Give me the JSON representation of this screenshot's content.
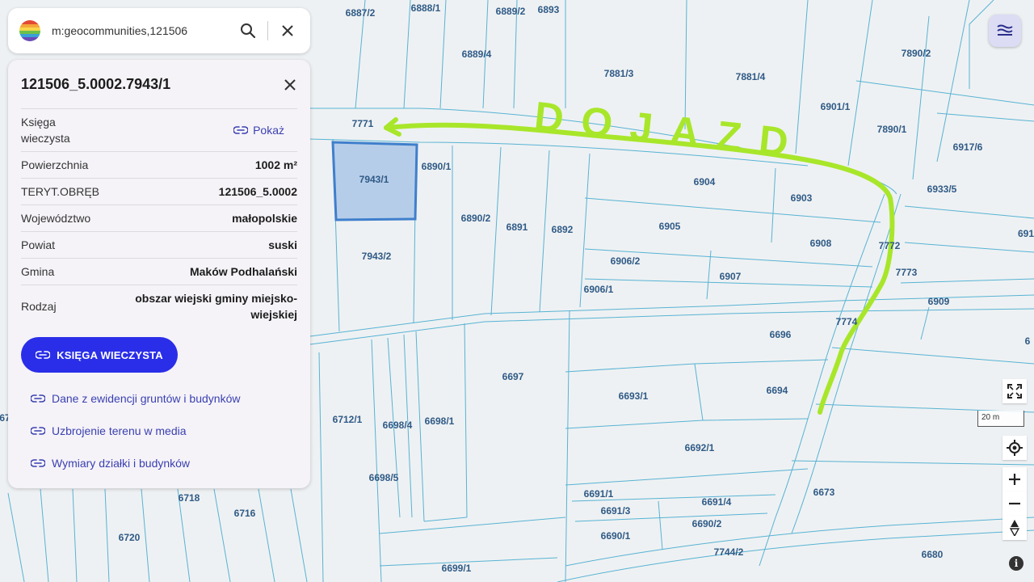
{
  "search": {
    "query": "m:geocommunities,121506"
  },
  "panel": {
    "title": "121506_5.0002.7943/1",
    "ksiega_label": "Księga wieczysta",
    "show_label": "Pokaż",
    "rows": [
      {
        "label": "Powierzchnia",
        "value": "1002 m²"
      },
      {
        "label": "TERYT.OBRĘB",
        "value": "121506_5.0002"
      },
      {
        "label": "Województwo",
        "value": "małopolskie"
      },
      {
        "label": "Powiat",
        "value": "suski"
      },
      {
        "label": "Gmina",
        "value": "Maków Podhalański"
      },
      {
        "label": "Rodzaj",
        "value": "obszar wiejski gminy miejsko-wiejskiej"
      }
    ],
    "button_label": "KSIĘGA WIECZYSTA",
    "links": [
      "Dane z ewidencji gruntów i budynków",
      "Uzbrojenie terenu w media",
      "Wymiary działki i budynków"
    ]
  },
  "map": {
    "parcels": [
      "6887/2",
      "6888/1",
      "6889/2",
      "6893",
      "6889/4",
      "7881/3",
      "7881/4",
      "7890/2",
      "7771",
      "6901/1",
      "7890/1",
      "6917/6",
      "7943/1",
      "6890/1",
      "6904",
      "6903",
      "6933/5",
      "6890/2",
      "6891",
      "6892",
      "6905",
      "6908",
      "7772",
      "691",
      "7943/2",
      "6906/2",
      "6907",
      "7773",
      "6906/1",
      "6909",
      "6696",
      "7774",
      "6697",
      "6693/1",
      "6694",
      "6712/1",
      "6698/4",
      "6698/1",
      "6692/1",
      "6698/5",
      "6673",
      "6718",
      "6716",
      "6691/1",
      "6691/4",
      "6691/3",
      "6690/2",
      "6720",
      "6690/1",
      "7744/2",
      "6680",
      "6699/1",
      "67",
      "6"
    ],
    "annotation": "DOJAZD",
    "scale_label": "20 m",
    "highlight_color": "#b6cde9",
    "annotation_color": "#a8e62a"
  }
}
